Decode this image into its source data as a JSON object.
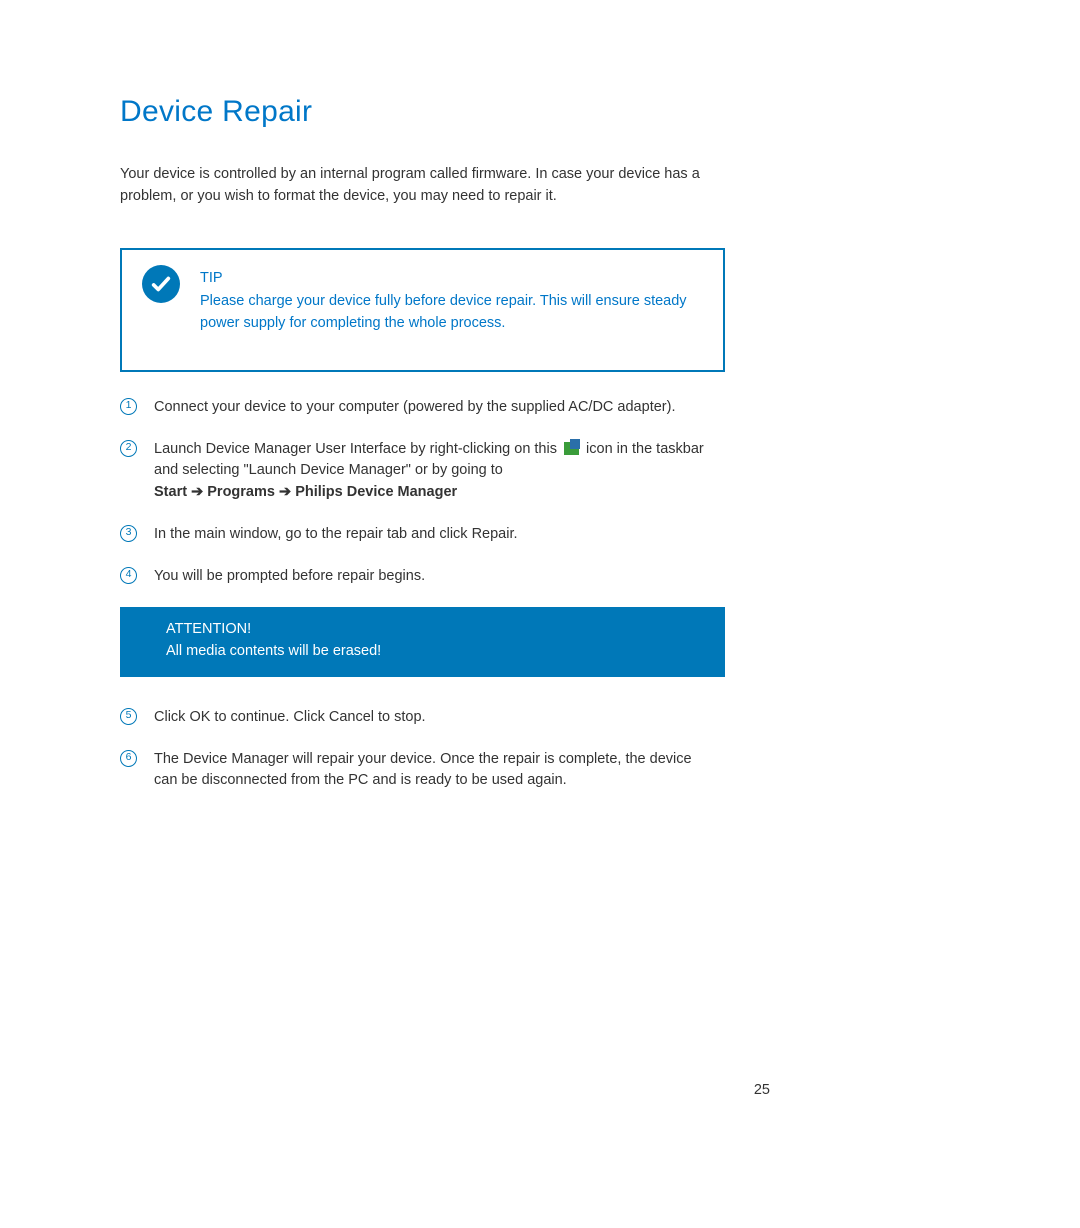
{
  "title": "Device Repair",
  "intro": "Your device is controlled by an internal program called firmware.  In case your device has a problem, or you wish to format the device, you may need to repair it.",
  "tip": {
    "label": "TIP",
    "text": "Please charge your device fully before device repair. This will ensure steady power supply for completing the whole process."
  },
  "steps": {
    "s1": {
      "num": "1",
      "text": "Connect your device to your computer (powered by the supplied AC/DC adapter)."
    },
    "s2": {
      "num": "2",
      "pre": "Launch Device Manager User Interface by right-clicking on this ",
      "post": " icon in the taskbar and selecting \"Launch Device Manager\" or by going to",
      "path_start": "Start",
      "path_programs": "Programs",
      "path_item": "Philips Device Manager"
    },
    "s3": {
      "num": "3",
      "text": "In the main window, go to the repair tab and click Repair."
    },
    "s4": {
      "num": "4",
      "text": "You will be prompted before repair begins."
    },
    "s5": {
      "num": "5",
      "text": "Click OK to continue. Click Cancel to stop."
    },
    "s6": {
      "num": "6",
      "text": "The Device Manager will repair your device. Once the repair is complete, the device can be disconnected from the PC and is ready to be used again."
    }
  },
  "attention": {
    "label": "ATTENTION!",
    "text": "All media contents will be erased!"
  },
  "arrow": "➔",
  "page_number": "25"
}
